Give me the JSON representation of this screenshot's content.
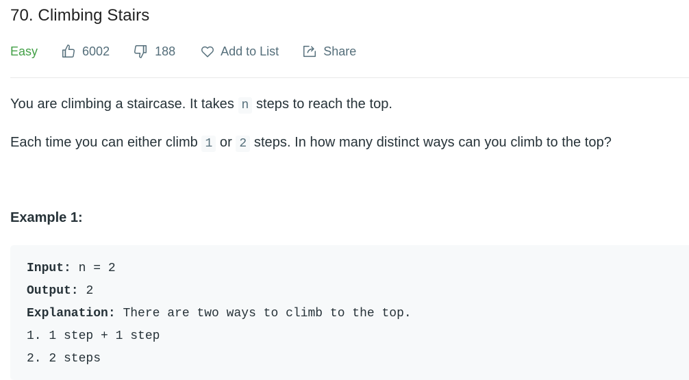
{
  "problem": {
    "title": "70. Climbing Stairs",
    "difficulty": "Easy",
    "likes": "6002",
    "dislikes": "188",
    "add_to_list_label": "Add to List",
    "share_label": "Share"
  },
  "description": {
    "p1_before": "You are climbing a staircase. It takes",
    "p1_code": "n",
    "p1_after": "steps to reach the top.",
    "p2_before": "Each time you can either climb",
    "p2_code1": "1",
    "p2_mid": "or",
    "p2_code2": "2",
    "p2_after": "steps. In how many distinct ways can you climb to the top?"
  },
  "example": {
    "heading": "Example 1:",
    "input_label": "Input:",
    "input_value": "n = 2",
    "output_label": "Output:",
    "output_value": "2",
    "explanation_label": "Explanation:",
    "explanation_value": "There are two ways to climb to the top.",
    "line1": "1. 1 step + 1 step",
    "line2": "2. 2 steps"
  },
  "colors": {
    "difficulty_easy": "#43a047",
    "meta_text": "#546e7a",
    "body_text": "#263238",
    "code_bg": "#f7f9fa"
  },
  "icons": {
    "like": "thumbs-up-icon",
    "dislike": "thumbs-down-icon",
    "add_to_list": "heart-icon",
    "share": "share-icon"
  }
}
